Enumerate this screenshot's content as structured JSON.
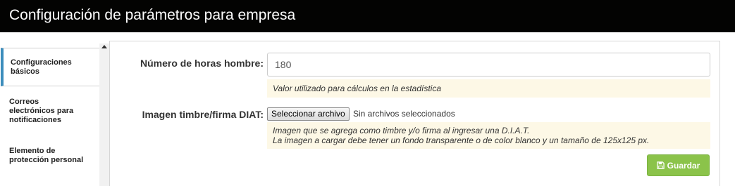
{
  "header": {
    "title": "Configuración de parámetros para empresa"
  },
  "sidebar": {
    "items": [
      {
        "label_lines": [
          "Configuraciones",
          "básicos"
        ],
        "active": true
      },
      {
        "label_lines": [
          "Correos",
          "electrónicos para",
          "notificaciones"
        ],
        "active": false
      },
      {
        "label_lines": [
          "Elemento de",
          "protección personal"
        ],
        "active": false
      }
    ]
  },
  "form": {
    "hours": {
      "label": "Número de horas hombre:",
      "value": "180",
      "help": "Valor utilizado para cálculos en la estadística"
    },
    "image": {
      "label": "Imagen timbre/firma DIAT:",
      "button_label": "Seleccionar archivo",
      "status": "Sin archivos seleccionados",
      "help_line1": "Imagen que se agrega como timbre y/o firma al ingresar una D.I.A.T.",
      "help_line2": "La imagen a cargar debe tener un fondo transparente o de color blanco y un tamaño de 125x125 px."
    },
    "save_label": "Guardar"
  },
  "colors": {
    "header_bg": "#030302",
    "active_accent": "#3c8dbc",
    "help_bg": "#fdf8e6",
    "save_bg": "#8bc34a"
  },
  "icons": {
    "save": "floppy-disk-icon",
    "scroll_up": "triangle-up-icon"
  }
}
